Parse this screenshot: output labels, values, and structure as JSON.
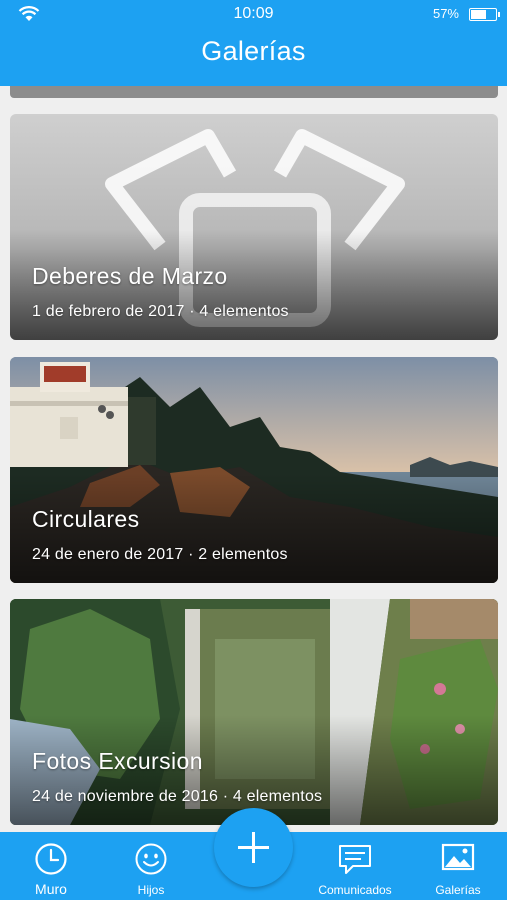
{
  "status": {
    "time": "10:09",
    "battery": "57%",
    "battery_level": 0.57
  },
  "header": {
    "title": "Galerías"
  },
  "galleries": [
    {
      "title": "Deberes de Marzo",
      "meta": "1 de febrero de 2017 · 4 elementos",
      "thumbnail": "placeholder-icon"
    },
    {
      "title": "Circulares",
      "meta": "24 de enero de 2017 · 2 elementos",
      "thumbnail": "lighthouse-photo"
    },
    {
      "title": "Fotos Excursion",
      "meta": "24 de noviembre de 2016 · 4 elementos",
      "thumbnail": "garden-photo"
    }
  ],
  "nav": {
    "muro": "Muro",
    "hijos": "Hijos",
    "comunicados": "Comunicados",
    "galerias": "Galerías",
    "active": "muro"
  },
  "colors": {
    "primary": "#1da1f2"
  }
}
